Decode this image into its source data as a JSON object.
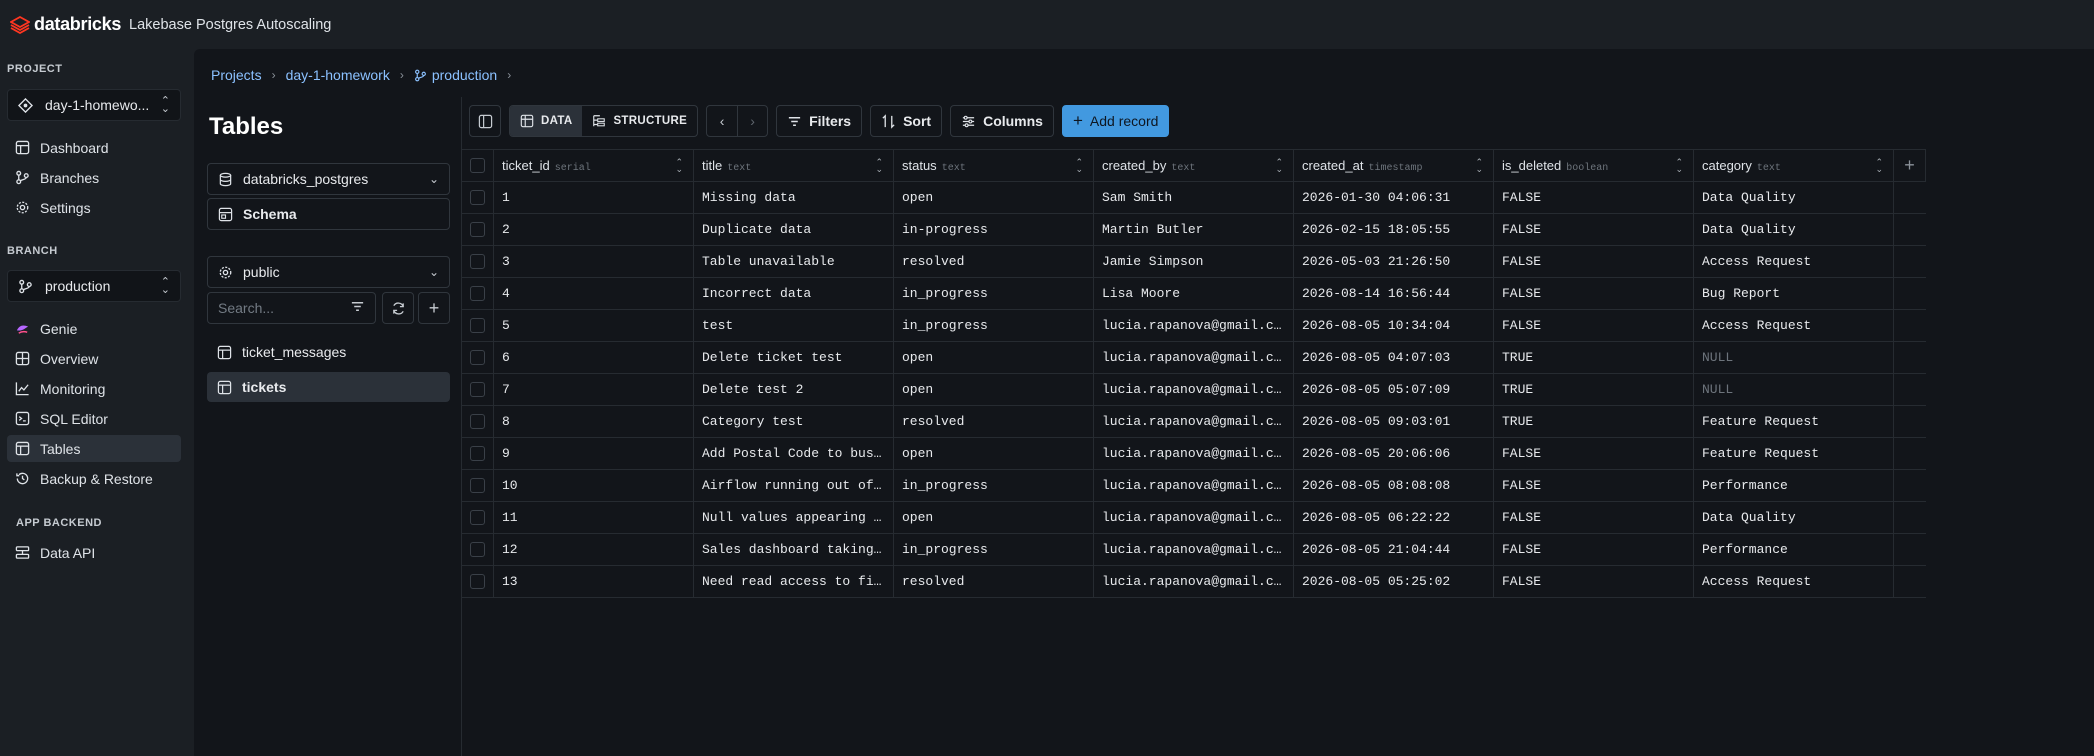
{
  "topbar": {
    "brand": "databricks",
    "app_title": "Lakebase Postgres Autoscaling"
  },
  "sidebar": {
    "project_label": "PROJECT",
    "project_value": "day-1-homewo...",
    "project_nav": [
      {
        "label": "Dashboard",
        "icon": "dashboard-icon"
      },
      {
        "label": "Branches",
        "icon": "branches-icon"
      },
      {
        "label": "Settings",
        "icon": "gear-icon"
      }
    ],
    "branch_label": "BRANCH",
    "branch_value": "production",
    "branch_nav": [
      {
        "label": "Genie",
        "icon": "genie-icon"
      },
      {
        "label": "Overview",
        "icon": "overview-icon"
      },
      {
        "label": "Monitoring",
        "icon": "monitoring-icon"
      },
      {
        "label": "SQL Editor",
        "icon": "sql-editor-icon"
      },
      {
        "label": "Tables",
        "icon": "tables-icon",
        "active": true
      },
      {
        "label": "Backup & Restore",
        "icon": "backup-icon"
      }
    ],
    "app_backend_label": "APP BACKEND",
    "app_backend_nav": [
      {
        "label": "Data API",
        "icon": "data-api-icon"
      }
    ]
  },
  "breadcrumb": {
    "projects": "Projects",
    "project": "day-1-homework",
    "branch": "production"
  },
  "tables_panel": {
    "title": "Tables",
    "database": "databricks_postgres",
    "schema_label": "Schema",
    "schema_value": "public",
    "search_placeholder": "Search...",
    "tables": [
      {
        "name": "ticket_messages",
        "active": false
      },
      {
        "name": "tickets",
        "active": true
      }
    ]
  },
  "toolbar": {
    "data_tab": "DATA",
    "structure_tab": "STRUCTURE",
    "filters": "Filters",
    "sort": "Sort",
    "columns": "Columns",
    "add_record": "Add record",
    "accent_color": "#4299e0"
  },
  "grid": {
    "columns": [
      {
        "name": "ticket_id",
        "type": "serial"
      },
      {
        "name": "title",
        "type": "text"
      },
      {
        "name": "status",
        "type": "text"
      },
      {
        "name": "created_by",
        "type": "text"
      },
      {
        "name": "created_at",
        "type": "timestamp"
      },
      {
        "name": "is_deleted",
        "type": "boolean"
      },
      {
        "name": "category",
        "type": "text"
      }
    ],
    "rows": [
      [
        "1",
        "Missing data",
        "open",
        "Sam Smith",
        "2026-01-30 04:06:31",
        "FALSE",
        "Data Quality"
      ],
      [
        "2",
        "Duplicate data",
        "in-progress",
        "Martin Butler",
        "2026-02-15 18:05:55",
        "FALSE",
        "Data Quality"
      ],
      [
        "3",
        "Table unavailable",
        "resolved",
        "Jamie Simpson",
        "2026-05-03 21:26:50",
        "FALSE",
        "Access Request"
      ],
      [
        "4",
        "Incorrect data",
        "in_progress",
        "Lisa Moore",
        "2026-08-14 16:56:44",
        "FALSE",
        "Bug Report"
      ],
      [
        "5",
        "test",
        "in_progress",
        "lucia.rapanova@gmail.c…",
        "2026-08-05 10:34:04",
        "FALSE",
        "Access Request"
      ],
      [
        "6",
        "Delete ticket test",
        "open",
        "lucia.rapanova@gmail.c…",
        "2026-08-05 04:07:03",
        "TRUE",
        "NULL"
      ],
      [
        "7",
        "Delete test 2",
        "open",
        "lucia.rapanova@gmail.c…",
        "2026-08-05 05:07:09",
        "TRUE",
        "NULL"
      ],
      [
        "8",
        "Category test",
        "resolved",
        "lucia.rapanova@gmail.c…",
        "2026-08-05 09:03:01",
        "TRUE",
        "Feature Request"
      ],
      [
        "9",
        "Add Postal Code to bus…",
        "open",
        "lucia.rapanova@gmail.c…",
        "2026-08-05 20:06:06",
        "FALSE",
        "Feature Request"
      ],
      [
        "10",
        "Airflow running out of…",
        "in_progress",
        "lucia.rapanova@gmail.c…",
        "2026-08-05 08:08:08",
        "FALSE",
        "Performance"
      ],
      [
        "11",
        "Null values appearing …",
        "open",
        "lucia.rapanova@gmail.c…",
        "2026-08-05 06:22:22",
        "FALSE",
        "Data Quality"
      ],
      [
        "12",
        "Sales dashboard taking…",
        "in_progress",
        "lucia.rapanova@gmail.c…",
        "2026-08-05 21:04:44",
        "FALSE",
        "Performance"
      ],
      [
        "13",
        "Need read access to fi…",
        "resolved",
        "lucia.rapanova@gmail.c…",
        "2026-08-05 05:25:02",
        "FALSE",
        "Access Request"
      ]
    ]
  }
}
